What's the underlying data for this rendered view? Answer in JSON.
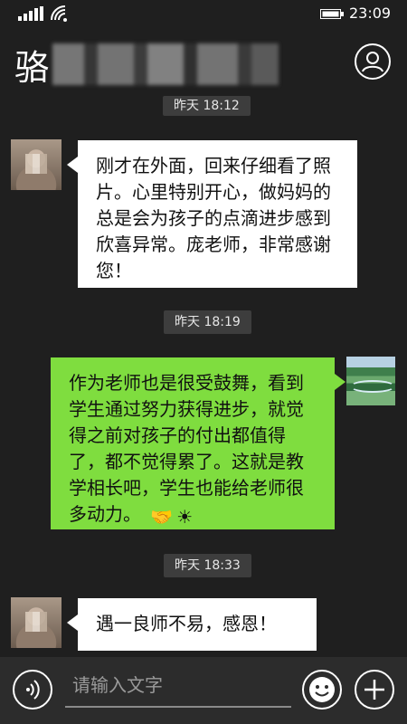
{
  "status_bar": {
    "time": "23:09",
    "icons": [
      "signal-icon",
      "wifi-icon",
      "battery-icon"
    ]
  },
  "header": {
    "title": "骆",
    "profile_icon": "profile-icon"
  },
  "messages": [
    {
      "type": "timestamp",
      "text": "昨天 18:12"
    },
    {
      "type": "incoming",
      "text": "刚才在外面，回来仔细看了照片。心里特别开心，做妈妈的总是会为孩子的点滴进步感到欣喜异常。庞老师，非常感谢您！"
    },
    {
      "type": "timestamp",
      "text": "昨天 18:19"
    },
    {
      "type": "outgoing",
      "text": "作为老师也是很受鼓舞，看到学生通过努力获得进步，就觉得之前对孩子的付出都值得了，都不觉得累了。这就是教学相长吧，学生也能给老师很多动力。",
      "emojis": [
        "handshake-emoji",
        "sun-emoji"
      ]
    },
    {
      "type": "timestamp",
      "text": "昨天 18:33"
    },
    {
      "type": "incoming",
      "text": "遇一良师不易，感恩！"
    }
  ],
  "input_bar": {
    "placeholder": "请输入文字",
    "value": "",
    "icons": [
      "voice-icon",
      "emoji-icon",
      "plus-icon"
    ]
  },
  "colors": {
    "background": "#1f1f1f",
    "outgoing_bubble": "#7fdd3f",
    "incoming_bubble": "#ffffff",
    "timestamp_bg": "#3d3d3d"
  }
}
